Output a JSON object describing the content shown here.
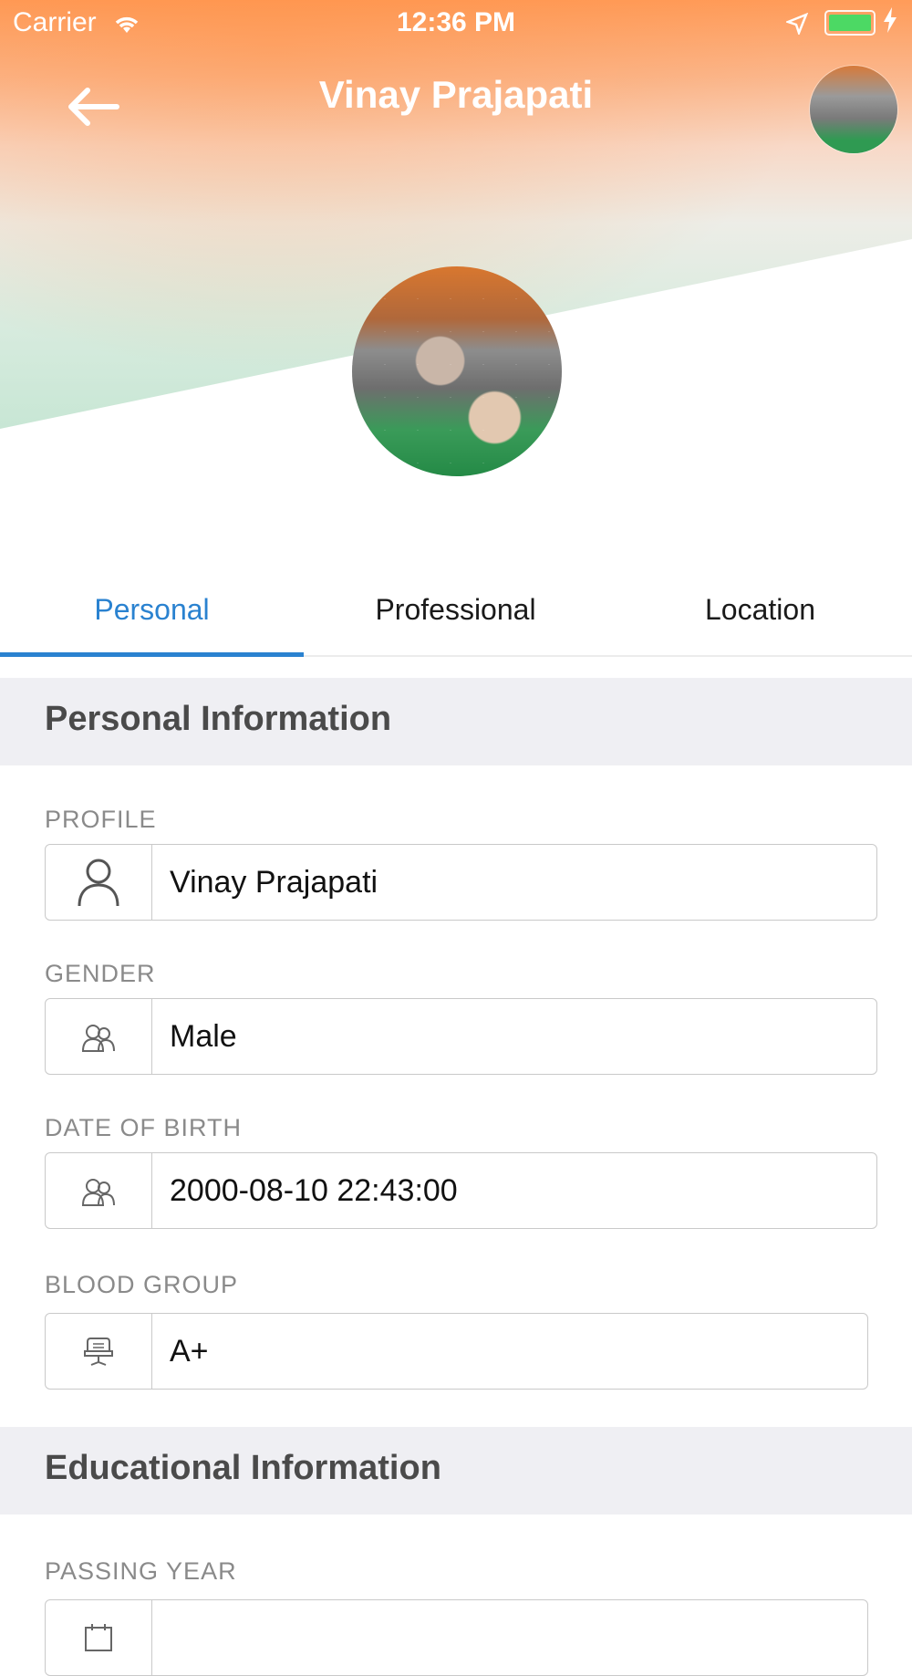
{
  "status": {
    "carrier": "Carrier",
    "time": "12:36 PM"
  },
  "header": {
    "title": "Vinay Prajapati"
  },
  "tabs": [
    {
      "label": "Personal",
      "active": true
    },
    {
      "label": "Professional",
      "active": false
    },
    {
      "label": "Location",
      "active": false
    }
  ],
  "sections": {
    "personal": "Personal Information",
    "educational": "Educational Information"
  },
  "fields": {
    "profile": {
      "label": "PROFILE",
      "value": "Vinay Prajapati",
      "icon": "user-icon"
    },
    "gender": {
      "label": "GENDER",
      "value": "Male",
      "icon": "gender-icon"
    },
    "dob": {
      "label": "DATE OF BIRTH",
      "value": "2000-08-10 22:43:00",
      "icon": "gender-icon"
    },
    "blood_group": {
      "label": "BLOOD GROUP",
      "value": "A+",
      "icon": "chair-icon"
    },
    "passing_year": {
      "label": "PASSING YEAR",
      "value": "",
      "icon": "calendar-icon"
    }
  },
  "colors": {
    "accent": "#2a82d0",
    "section_bg": "#efeff3",
    "battery": "#4cd964"
  }
}
